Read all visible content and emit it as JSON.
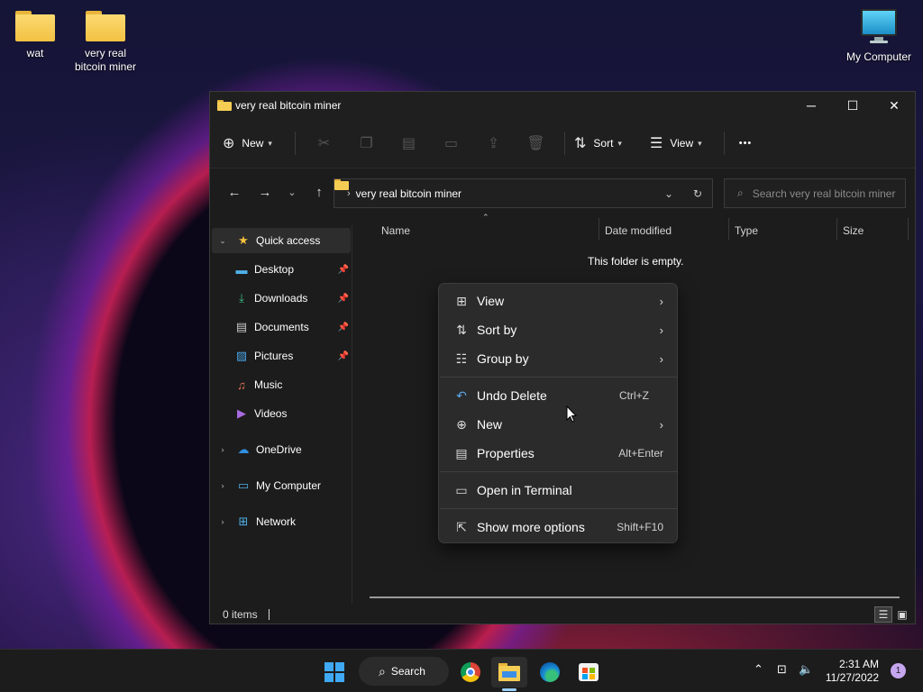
{
  "desktop": {
    "icons": [
      {
        "label": "wat"
      },
      {
        "label": "very real\nbitcoin miner"
      },
      {
        "label": "My Computer"
      }
    ]
  },
  "window": {
    "title": "very real bitcoin miner",
    "controls": {
      "minimize": "─",
      "maximize": "☐",
      "close": "✕"
    }
  },
  "toolbar": {
    "new_label": "New",
    "sort_label": "Sort",
    "view_label": "View",
    "more": "•••"
  },
  "address": {
    "path": "very real bitcoin miner",
    "search_placeholder": "Search very real bitcoin miner"
  },
  "nav": {
    "quick_access": "Quick access",
    "items": [
      {
        "label": "Desktop",
        "pinned": true
      },
      {
        "label": "Downloads",
        "pinned": true
      },
      {
        "label": "Documents",
        "pinned": true
      },
      {
        "label": "Pictures",
        "pinned": true
      },
      {
        "label": "Music",
        "pinned": false
      },
      {
        "label": "Videos",
        "pinned": false
      }
    ],
    "onedrive": "OneDrive",
    "my_computer": "My Computer",
    "network": "Network"
  },
  "content": {
    "columns": [
      "Name",
      "Date modified",
      "Type",
      "Size"
    ],
    "empty_message": "This folder is empty."
  },
  "status": {
    "items_count": "0 items"
  },
  "context_menu": {
    "items": [
      {
        "label": "View",
        "shortcut": "",
        "submenu": true,
        "icon": "grid-icon"
      },
      {
        "label": "Sort by",
        "shortcut": "",
        "submenu": true,
        "icon": "sort-icon"
      },
      {
        "label": "Group by",
        "shortcut": "",
        "submenu": true,
        "icon": "list-icon"
      },
      {
        "label": "Undo Delete",
        "shortcut": "Ctrl+Z",
        "submenu": false,
        "icon": "undo-icon"
      },
      {
        "label": "New",
        "shortcut": "",
        "submenu": true,
        "icon": "plus-circle-icon"
      },
      {
        "label": "Properties",
        "shortcut": "Alt+Enter",
        "submenu": false,
        "icon": "properties-icon"
      },
      {
        "label": "Open in Terminal",
        "shortcut": "",
        "submenu": false,
        "icon": "terminal-icon"
      },
      {
        "label": "Show more options",
        "shortcut": "Shift+F10",
        "submenu": false,
        "icon": "share-icon"
      }
    ]
  },
  "taskbar": {
    "search_label": "Search",
    "time": "2:31 AM",
    "date": "11/27/2022",
    "notification_count": "1"
  },
  "colors": {
    "accent": "#3fa9f5",
    "window_bg": "#1c1c1c",
    "menu_bg": "#2b2b2b",
    "folder": "#f6cd54"
  }
}
